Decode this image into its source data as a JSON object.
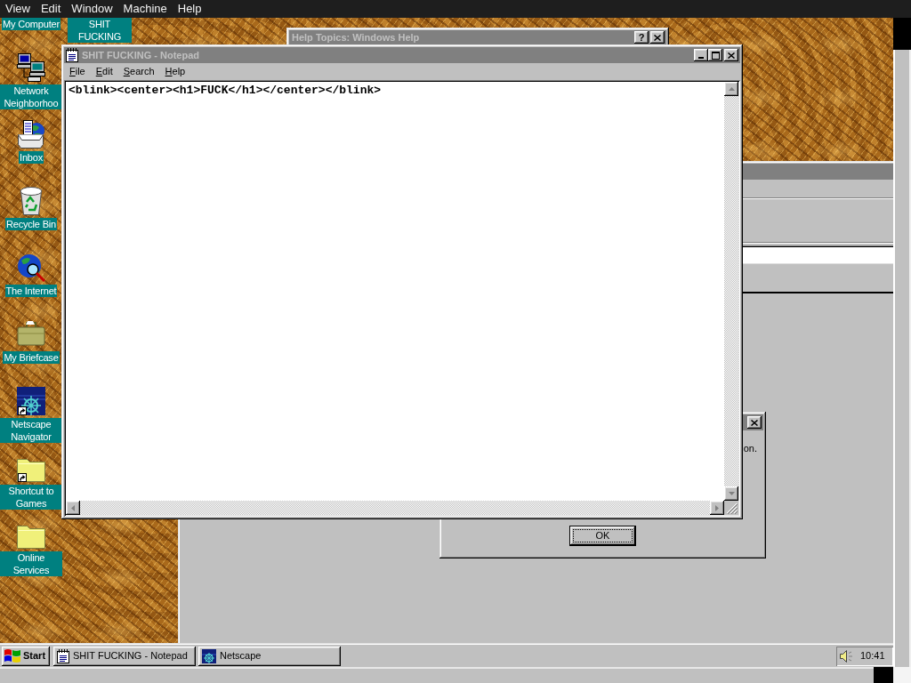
{
  "host_menu": [
    "View",
    "Edit",
    "Window",
    "Machine",
    "Help"
  ],
  "desktop_icons": [
    {
      "label": "My Computer",
      "kind": "label",
      "shortcut": false
    },
    {
      "label": "SHIT FUCKING",
      "kind": "label",
      "shortcut": false
    },
    {
      "label": "Network Neighborhoo",
      "kind": "network",
      "shortcut": false
    },
    {
      "label": "Inbox",
      "kind": "inbox",
      "shortcut": false
    },
    {
      "label": "Recycle Bin",
      "kind": "recycle",
      "shortcut": false
    },
    {
      "label": "The Internet",
      "kind": "internet",
      "shortcut": false
    },
    {
      "label": "My Briefcase",
      "kind": "briefcase",
      "shortcut": false
    },
    {
      "label": "Netscape Navigator",
      "kind": "netscape",
      "shortcut": true
    },
    {
      "label": "Shortcut to Games",
      "kind": "folder",
      "shortcut": true
    },
    {
      "label": "Online Services",
      "kind": "folder",
      "shortcut": false
    }
  ],
  "browser_window": {
    "active": false
  },
  "help_window": {
    "title": "Help Topics: Windows Help",
    "help_button": "?",
    "active": false
  },
  "dialog": {
    "active": false,
    "message": "on.",
    "buttons": [
      {
        "label": "OK",
        "default": true
      }
    ]
  },
  "notepad": {
    "title": "SHIT FUCKING - Notepad",
    "active": false,
    "menu": [
      "File",
      "Edit",
      "Search",
      "Help"
    ],
    "text": "<blink><center><h1>FUCK</h1></center></blink>"
  },
  "taskbar": {
    "start": "Start",
    "tasks": [
      {
        "label": "SHIT FUCKING - Notepad",
        "kind": "notepad",
        "selected": false
      },
      {
        "label": "Netscape",
        "kind": "netscape",
        "selected": false
      }
    ],
    "clock": "10:41"
  }
}
